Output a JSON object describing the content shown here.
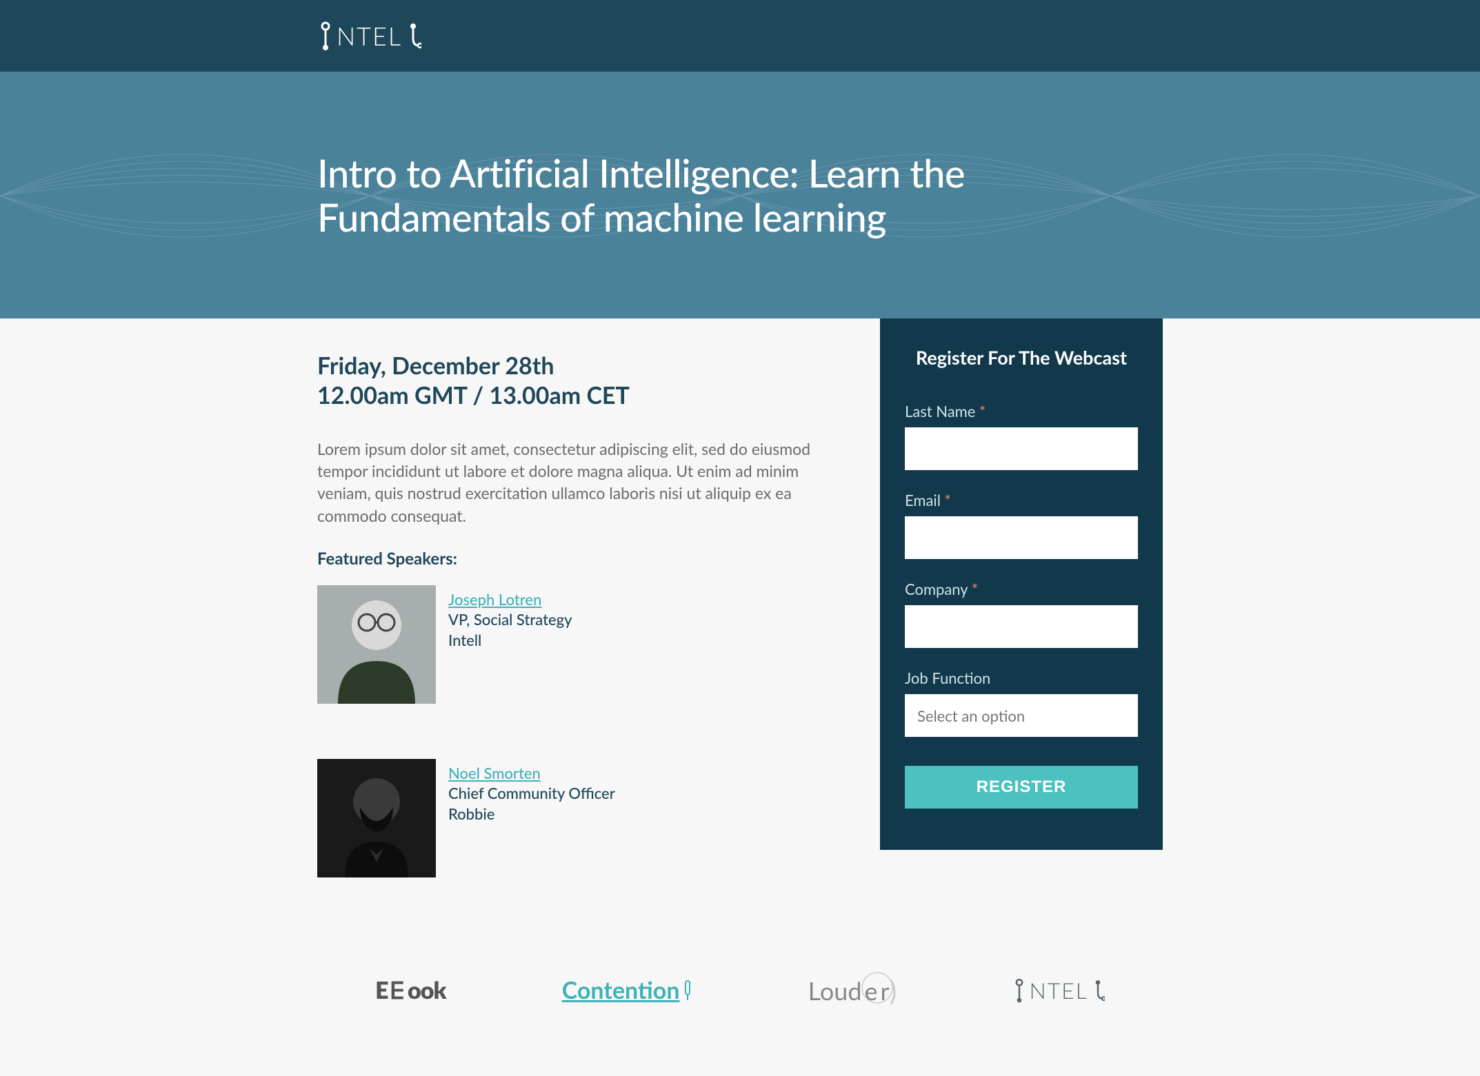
{
  "header": {
    "brand": "NTEL"
  },
  "hero": {
    "title": "Intro to Artificial Intelligence: Learn the Fundamentals of machine learning"
  },
  "content": {
    "date": "Friday, December 28th",
    "time": "12.00am GMT / 13.00am CET",
    "description": "Lorem ipsum dolor sit amet, consectetur adipiscing elit, sed do eiusmod tempor incididunt ut labore et dolore magna aliqua. Ut enim ad minim veniam, quis nostrud exercitation ullamco laboris nisi ut aliquip ex ea commodo consequat.",
    "featured_label": "Featured Speakers:",
    "speakers": [
      {
        "name": "Joseph Lotren",
        "title": "VP, Social Strategy",
        "org": "Intell"
      },
      {
        "name": "Noel Smorten",
        "title": "Chief Community Officer",
        "org": "Robbie"
      }
    ]
  },
  "form": {
    "title": "Register For The Webcast",
    "fields": {
      "last_name": {
        "label": "Last Name",
        "required": true
      },
      "email": {
        "label": "Email",
        "required": true
      },
      "company": {
        "label": "Company",
        "required": true
      },
      "job_function": {
        "label": "Job Function",
        "placeholder": "Select an option",
        "required": false
      }
    },
    "submit": "REGISTER"
  },
  "brands": {
    "ebook": "EBook",
    "contention": "Contention",
    "louder": "Louder",
    "intell": "NTEL"
  }
}
